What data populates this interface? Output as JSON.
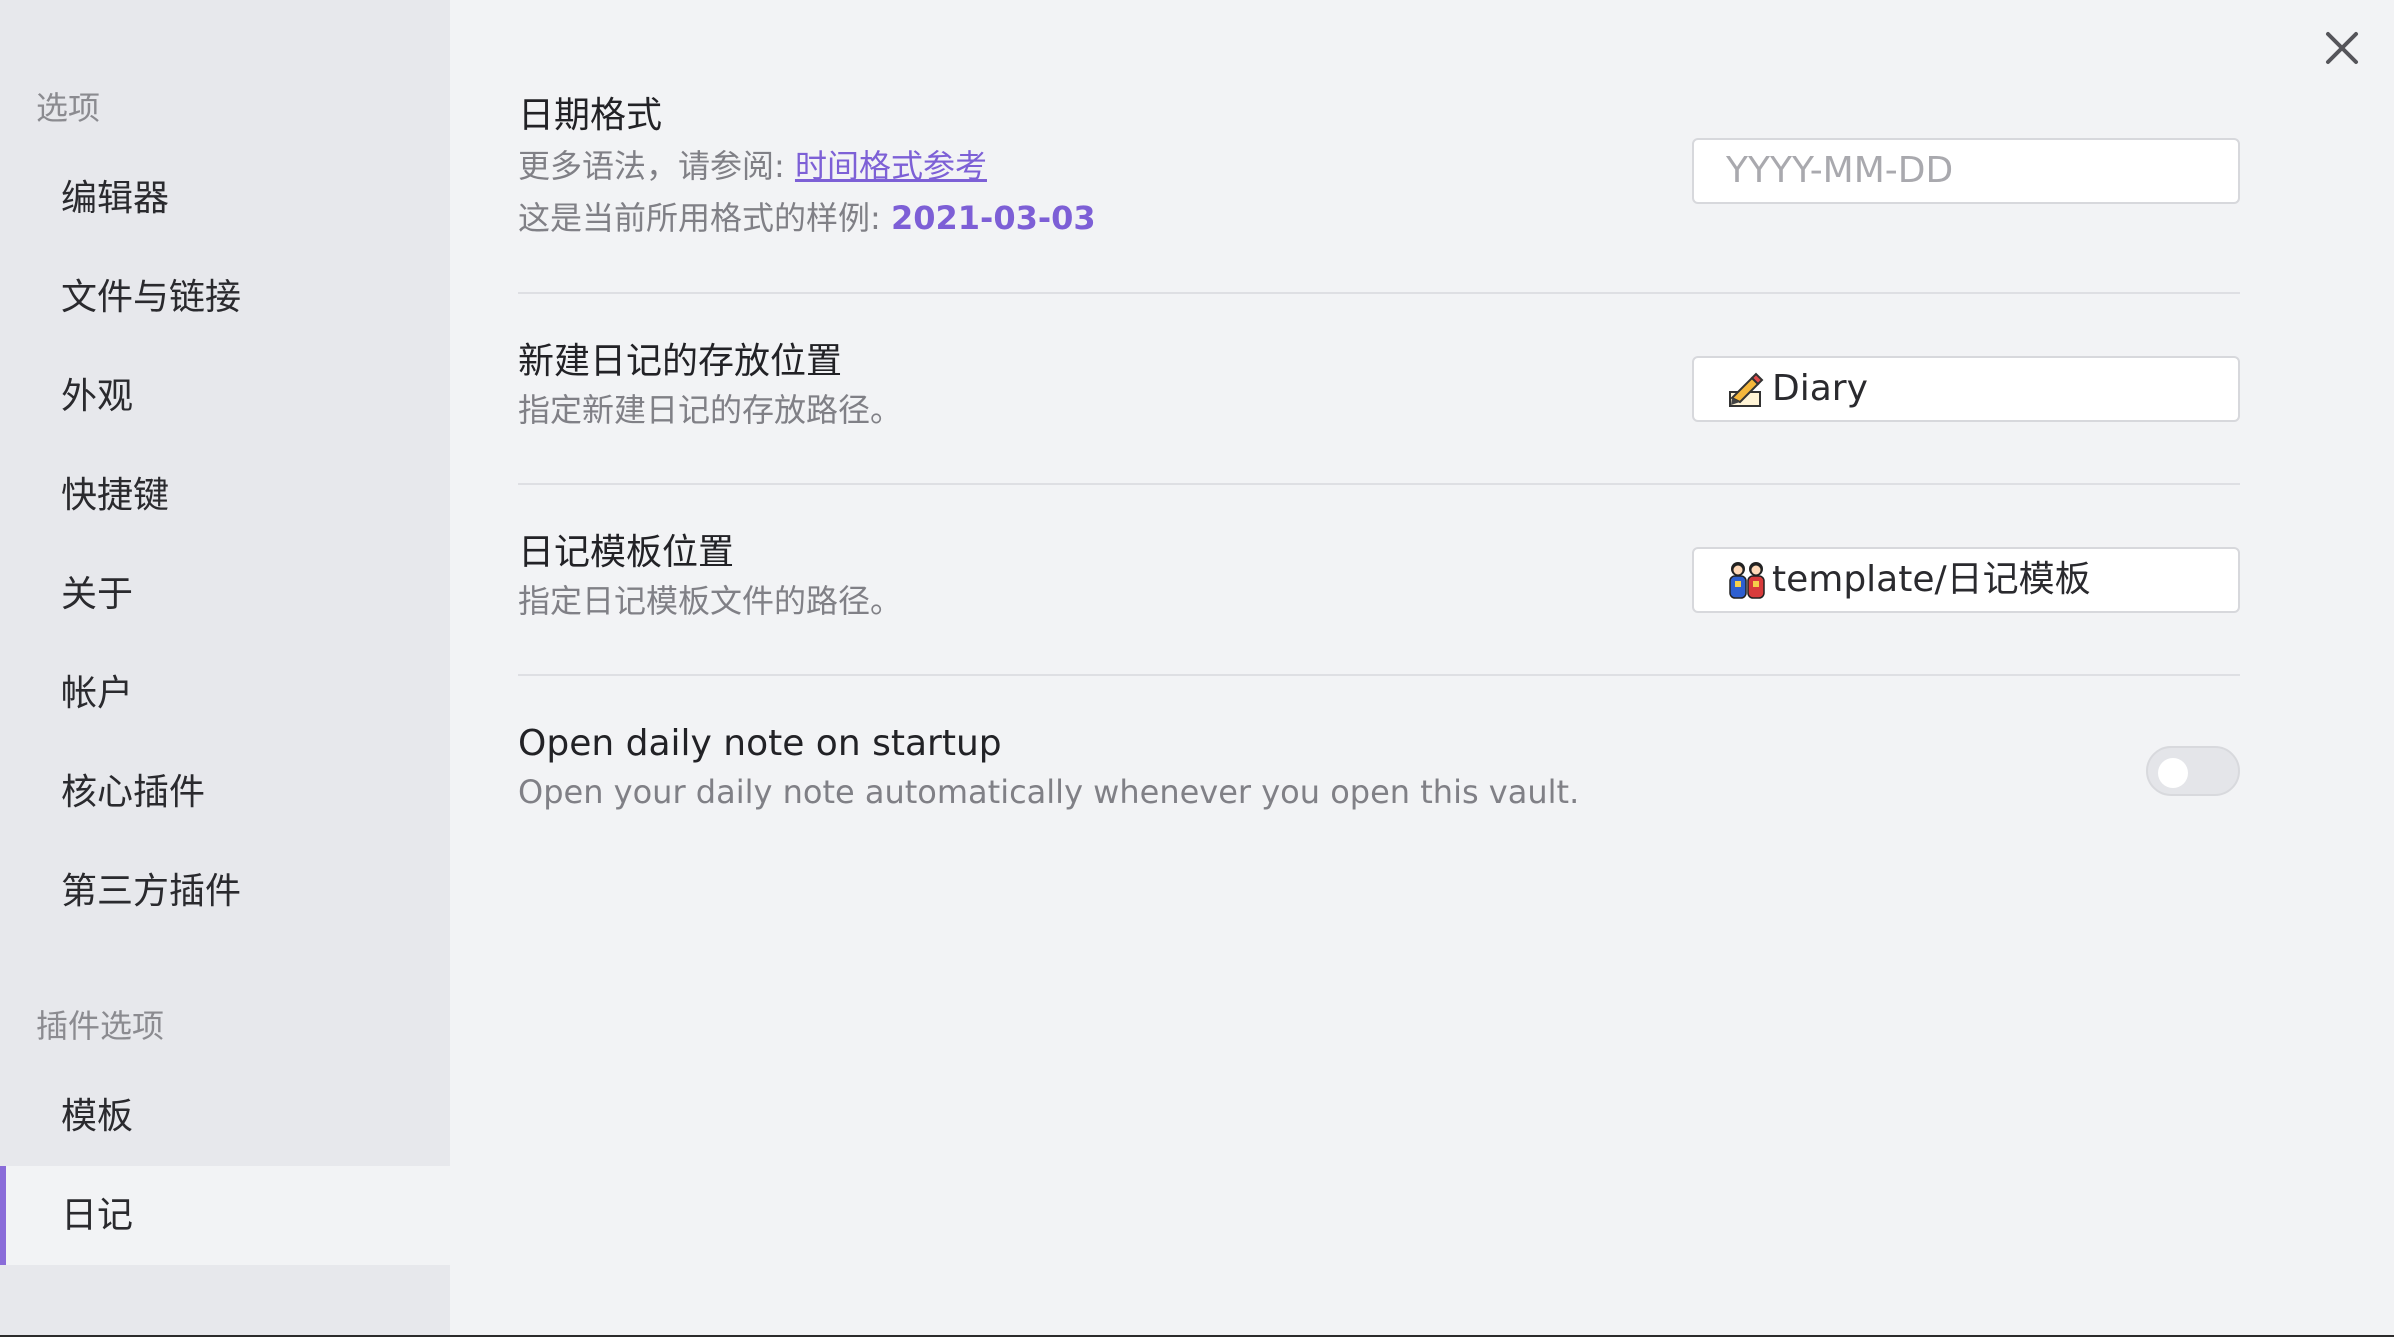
{
  "sidebar": {
    "options_heading": "选项",
    "items": [
      {
        "label": "编辑器"
      },
      {
        "label": "文件与链接"
      },
      {
        "label": "外观"
      },
      {
        "label": "快捷键"
      },
      {
        "label": "关于"
      },
      {
        "label": "帐户"
      },
      {
        "label": "核心插件"
      },
      {
        "label": "第三方插件"
      }
    ],
    "plugin_heading": "插件选项",
    "plugin_items": [
      {
        "label": "模板"
      },
      {
        "label": "日记",
        "active": true
      }
    ]
  },
  "settings": {
    "date_format": {
      "name": "日期格式",
      "desc_prefix": "更多语法，请参阅: ",
      "link_text": "时间格式参考",
      "sample_prefix": "这是当前所用格式的样例: ",
      "sample_value": "2021-03-03",
      "input_placeholder": "YYYY-MM-DD"
    },
    "new_file_location": {
      "name": "新建日记的存放位置",
      "desc": "指定新建日记的存放路径。",
      "value": "Diary",
      "icon": "writing-hand-icon"
    },
    "template_location": {
      "name": "日记模板位置",
      "desc": "指定日记模板文件的路径。",
      "value": "template/日记模板",
      "icon": "dolls-icon"
    },
    "open_on_startup": {
      "name": "Open daily note on startup",
      "desc": "Open your daily note automatically whenever you open this vault.",
      "enabled": false
    }
  },
  "colors": {
    "accent": "#7d60d6",
    "sidebar_bg": "#e7e8ec",
    "main_bg": "#f2f3f5"
  }
}
